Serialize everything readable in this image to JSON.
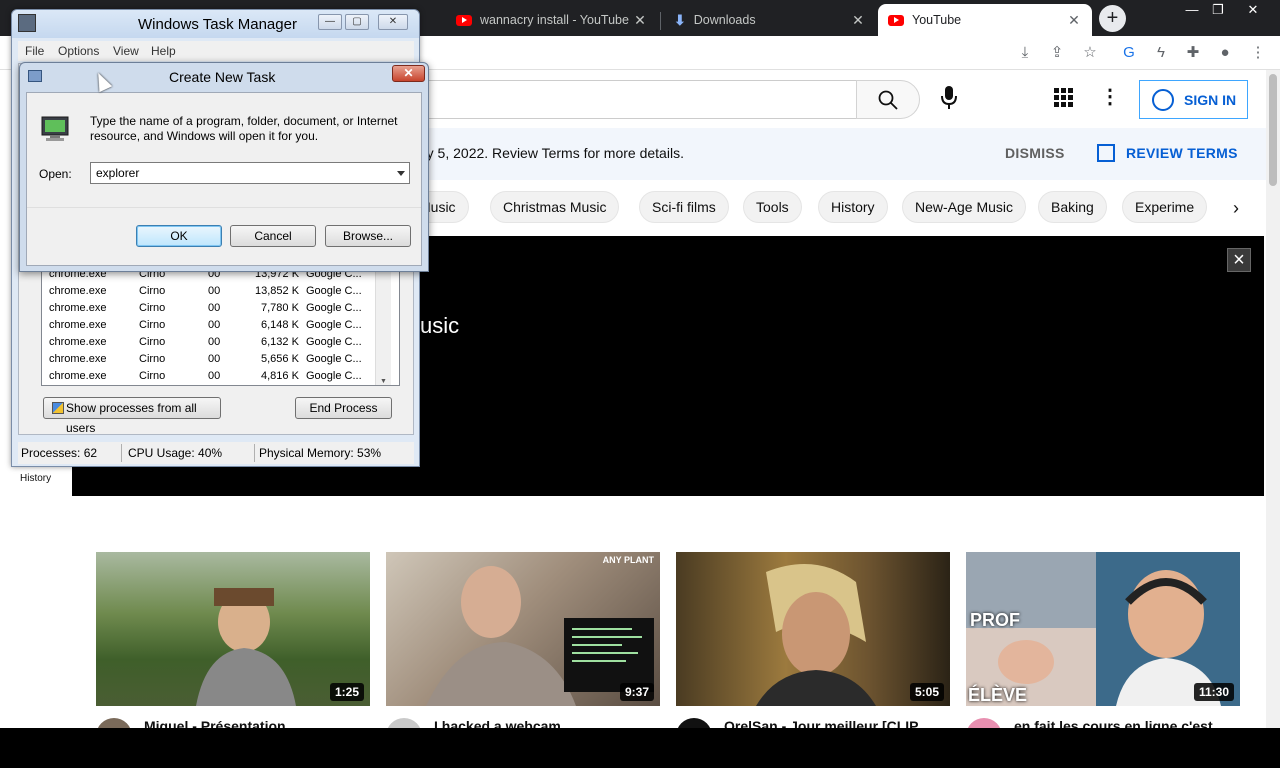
{
  "browser": {
    "tabs": [
      {
        "title": "wannacry install - YouTube",
        "icon": "youtube-favicon"
      },
      {
        "title": "Downloads",
        "icon": "download-icon"
      },
      {
        "title": "YouTube",
        "icon": "youtube-favicon",
        "active": true
      }
    ],
    "new_tab": "+",
    "window_controls": {
      "minimize": "—",
      "restore": "❐",
      "close": "✕"
    },
    "toolbar_icons": [
      "install-app-icon",
      "share-icon",
      "bookmark-star-icon",
      "translate-icon",
      "extension-bolt-icon",
      "extensions-puzzle-icon",
      "profile-icon",
      "chrome-menu-icon"
    ]
  },
  "youtube": {
    "search_placeholder": "",
    "signin_label": "SIGN IN",
    "terms_text": "ry 5, 2022. Review Terms for more details.",
    "dismiss_label": "DISMISS",
    "review_terms_label": "REVIEW TERMS",
    "chips": [
      "Music",
      "Christmas Music",
      "Sci-fi films",
      "Tools",
      "History",
      "New-Age Music",
      "Baking",
      "Experime"
    ],
    "banner_title": "usic",
    "sidebar_history": "History",
    "videos": [
      {
        "title": "Miguel - Présentation",
        "duration": "1:25"
      },
      {
        "title": "I hacked a webcam",
        "duration": "9:37",
        "badge": "ANY PLANT"
      },
      {
        "title": "OrelSan - Jour meilleur [CLIP",
        "duration": "5:05"
      },
      {
        "title": "en fait les cours en ligne c'est",
        "duration": "11:30",
        "overlay_top": "PROF",
        "overlay_bottom": "ÉLÈVE"
      }
    ]
  },
  "task_manager": {
    "title": "Windows Task Manager",
    "menu": [
      "File",
      "Options",
      "View",
      "Help"
    ],
    "processes": [
      {
        "name": "chrome.exe",
        "user": "Cirno",
        "cpu": "00",
        "memory": "13,972 K",
        "description": "Google C..."
      },
      {
        "name": "chrome.exe",
        "user": "Cirno",
        "cpu": "00",
        "memory": "13,852 K",
        "description": "Google C..."
      },
      {
        "name": "chrome.exe",
        "user": "Cirno",
        "cpu": "00",
        "memory": "7,780 K",
        "description": "Google C..."
      },
      {
        "name": "chrome.exe",
        "user": "Cirno",
        "cpu": "00",
        "memory": "6,148 K",
        "description": "Google C..."
      },
      {
        "name": "chrome.exe",
        "user": "Cirno",
        "cpu": "00",
        "memory": "6,132 K",
        "description": "Google C..."
      },
      {
        "name": "chrome.exe",
        "user": "Cirno",
        "cpu": "00",
        "memory": "5,656 K",
        "description": "Google C..."
      },
      {
        "name": "chrome.exe",
        "user": "Cirno",
        "cpu": "00",
        "memory": "4,816 K",
        "description": "Google C..."
      }
    ],
    "show_all_label": "Show processes from all users",
    "end_process_label": "End Process",
    "status": {
      "processes": "Processes: 62",
      "cpu": "CPU Usage: 40%",
      "memory": "Physical Memory: 53%"
    }
  },
  "create_task": {
    "title": "Create New Task",
    "description": "Type the name of a program, folder, document, or Internet resource, and Windows will open it for you.",
    "open_label": "Open:",
    "open_value": "explorer",
    "ok_label": "OK",
    "cancel_label": "Cancel",
    "browse_label": "Browse..."
  },
  "colors": {
    "youtube_red": "#ff0000",
    "link_blue": "#065fd4",
    "chrome_dark": "#202124"
  }
}
